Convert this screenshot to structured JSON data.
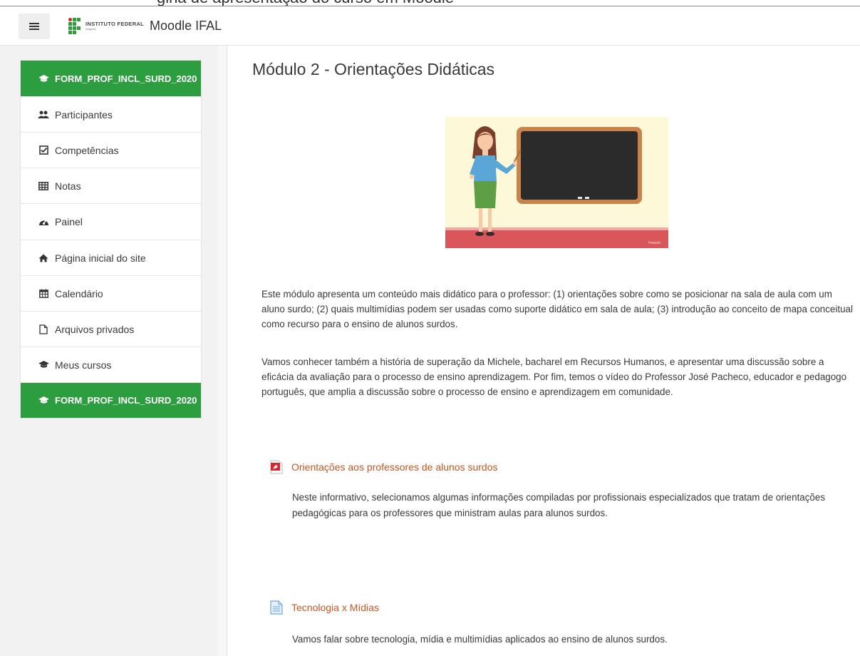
{
  "top_partial_text": "gina de apresentação do curso em Moodle",
  "navbar": {
    "menu_label": "",
    "logo_institution": "INSTITUTO FEDERAL",
    "logo_campus": "Alagoas",
    "brand": "Moodle IFAL"
  },
  "sidebar": {
    "course_items": [
      {
        "label": "FORM_PROF_INCL_SURD_2020",
        "icon": "graduation-cap-icon"
      },
      {
        "label": "Participantes",
        "icon": "users-icon"
      },
      {
        "label": "Competências",
        "icon": "checkbox-icon"
      },
      {
        "label": "Notas",
        "icon": "table-icon"
      }
    ],
    "site_items": [
      {
        "label": "Painel",
        "icon": "dashboard-icon"
      },
      {
        "label": "Página inicial do site",
        "icon": "home-icon"
      },
      {
        "label": "Calendário",
        "icon": "calendar-icon"
      },
      {
        "label": "Arquivos privados",
        "icon": "file-icon"
      },
      {
        "label": "Meus cursos",
        "icon": "graduation-cap-icon"
      },
      {
        "label": "FORM_PROF_INCL_SURD_2020",
        "icon": "graduation-cap-icon"
      }
    ]
  },
  "main": {
    "title": "Módulo 2 - Orientações Didáticas",
    "intro_paragraph_1": "Este módulo apresenta um conteúdo mais didático para o professor: (1) orientações sobre como se posicionar na sala de aula com um aluno surdo; (2) quais multimídias podem ser usadas como suporte didático em sala de aula; (3) introdução ao conceito de mapa conceitual como recurso para o ensino de alunos surdos.",
    "intro_paragraph_2": "Vamos conhecer também a história de superação da Michele, bacharel em Recursos Humanos, e apresentar uma discussão sobre a eficácia da avaliação para o processo de ensino aprendizagem. Por fim, temos o vídeo do Professor José Pacheco, educador e pedagogo português, que amplia a discussão sobre o processo de ensino e aprendizagem em comunidade.",
    "activities": [
      {
        "title": "Orientações aos professores de alunos surdos",
        "icon": "pdf-icon",
        "description": "Neste informativo, selecionamos algumas informações compiladas por profissionais especializados que tratam de orientações pedagógicas para os professores que ministram aulas para alunos surdos."
      },
      {
        "title": "Tecnologia x Mídias",
        "icon": "page-icon",
        "description": "Vamos falar sobre tecnologia, mídia e multimídias aplicados ao ensino de alunos surdos."
      }
    ],
    "colors": {
      "accent_green": "#2d9e3f",
      "link_orange": "#c45622"
    }
  }
}
